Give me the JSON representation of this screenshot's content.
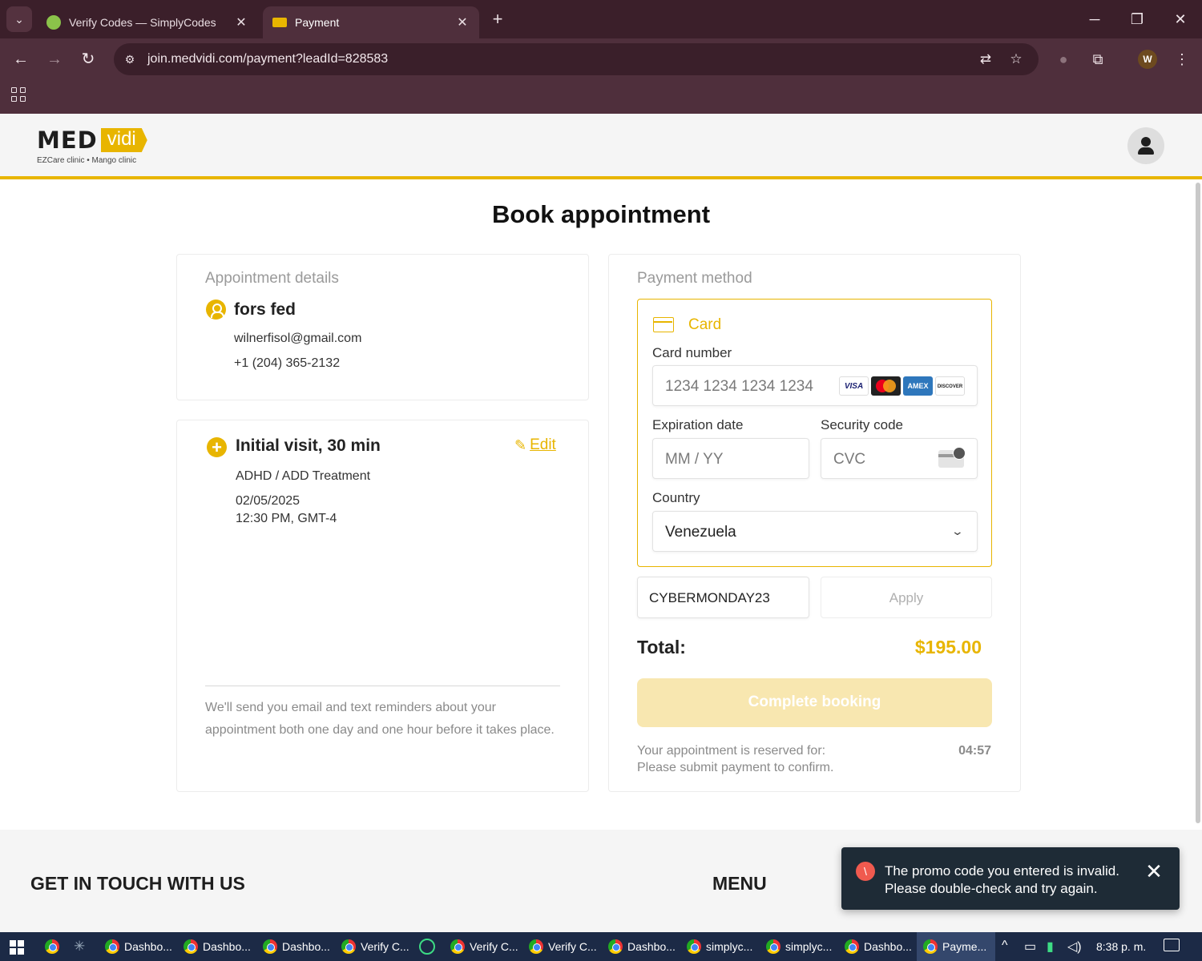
{
  "browser": {
    "tabs": [
      {
        "title": "Verify Codes — SimplyCodes",
        "active": false
      },
      {
        "title": "Payment",
        "active": true
      }
    ],
    "url": "join.medvidi.com/payment?leadId=828583",
    "profile_initial": "W"
  },
  "site": {
    "logo_med": "MED",
    "logo_vidi": "vidi",
    "logo_tagline": "EZCare clinic • Mango clinic"
  },
  "page": {
    "title": "Book appointment"
  },
  "appointment": {
    "section_label": "Appointment details",
    "name": "fors fed",
    "email": "wilnerfisol@gmail.com",
    "phone": "+1 (204) 365-2132"
  },
  "visit": {
    "title": "Initial visit, 30 min",
    "edit_label": "Edit",
    "treatment": "ADHD / ADD Treatment",
    "date": "02/05/2025",
    "time": "12:30 PM, GMT-4",
    "reminder_note": "We'll send you email and text reminders about your appointment both one day and one hour before it takes place."
  },
  "payment": {
    "section_label": "Payment method",
    "method_label": "Card",
    "card_number_label": "Card number",
    "card_number_placeholder": "1234 1234 1234 1234",
    "card_brands": [
      "VISA",
      "mastercard",
      "AMEX",
      "DISCOVER"
    ],
    "expiration_label": "Expiration date",
    "expiration_placeholder": "MM / YY",
    "security_label": "Security code",
    "security_placeholder": "CVC",
    "country_label": "Country",
    "country_value": "Venezuela",
    "promo_value": "CYBERMONDAY23",
    "apply_label": "Apply",
    "total_label": "Total:",
    "total_value": "$195.00",
    "complete_label": "Complete booking",
    "reserved_line1": "Your appointment is reserved for:",
    "reserved_line2": "Please submit payment to confirm.",
    "countdown": "04:57"
  },
  "footer": {
    "contact_heading": "GET IN TOUCH WITH US",
    "menu_heading": "MENU"
  },
  "toast": {
    "line1": "The promo code you entered is invalid.",
    "line2": "Please double-check and try again."
  },
  "taskbar": {
    "items": [
      "Dashbo...",
      "Dashbo...",
      "Dashbo...",
      "Verify C...",
      "Verify C...",
      "Verify C...",
      "Dashbo...",
      "simplyc...",
      "simplyc...",
      "Dashbo...",
      "Payme..."
    ],
    "clock": "8:38 p. m."
  },
  "colors": {
    "accent": "#e8b500",
    "tab_bar": "#3b1f2a",
    "toolbar": "#4f2f3c",
    "toast_bg": "#1e2b36",
    "error": "#f05a4f"
  }
}
